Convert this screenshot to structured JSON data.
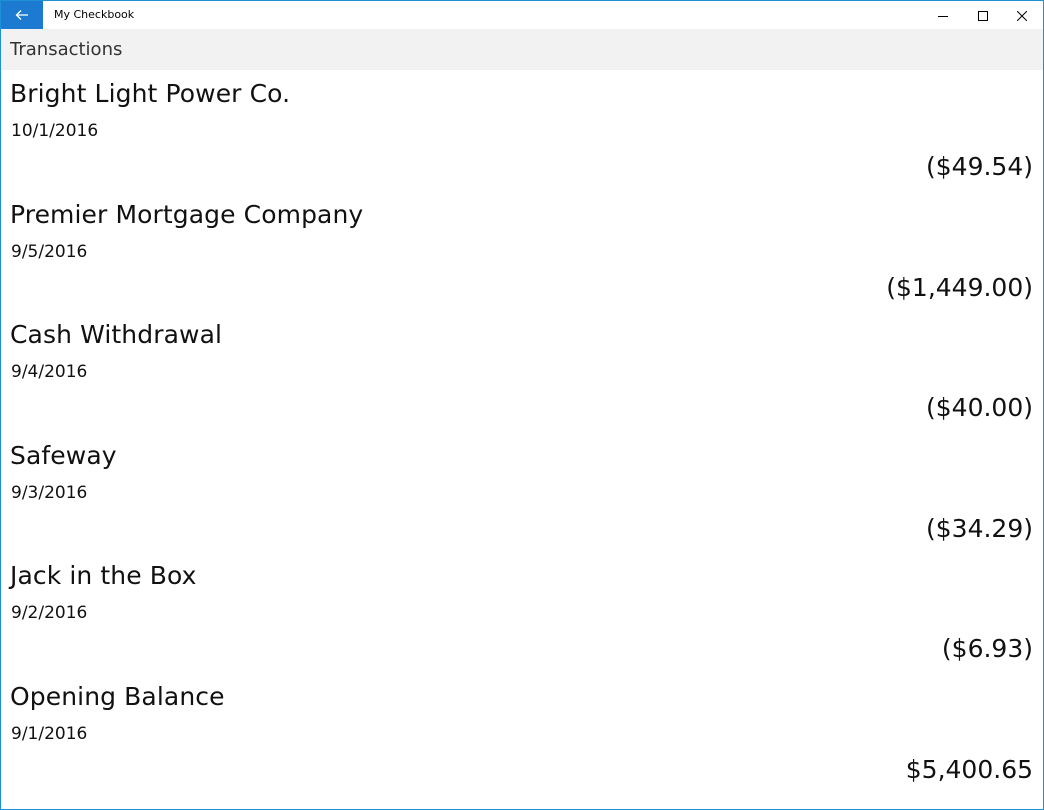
{
  "window": {
    "title": "My Checkbook",
    "accent_color": "#1c7bd0"
  },
  "icons": {
    "back": "back-arrow-icon",
    "minimize": "minimize-icon",
    "maximize": "maximize-icon",
    "close": "close-icon"
  },
  "header": {
    "title": "Transactions"
  },
  "transactions": [
    {
      "payee": "Bright Light Power Co.",
      "date": "10/1/2016",
      "amount": "($49.54)"
    },
    {
      "payee": "Premier Mortgage Company",
      "date": "9/5/2016",
      "amount": "($1,449.00)"
    },
    {
      "payee": "Cash Withdrawal",
      "date": "9/4/2016",
      "amount": "($40.00)"
    },
    {
      "payee": "Safeway",
      "date": "9/3/2016",
      "amount": "($34.29)"
    },
    {
      "payee": "Jack in the Box",
      "date": "9/2/2016",
      "amount": "($6.93)"
    },
    {
      "payee": "Opening Balance",
      "date": "9/1/2016",
      "amount": "$5,400.65"
    }
  ]
}
